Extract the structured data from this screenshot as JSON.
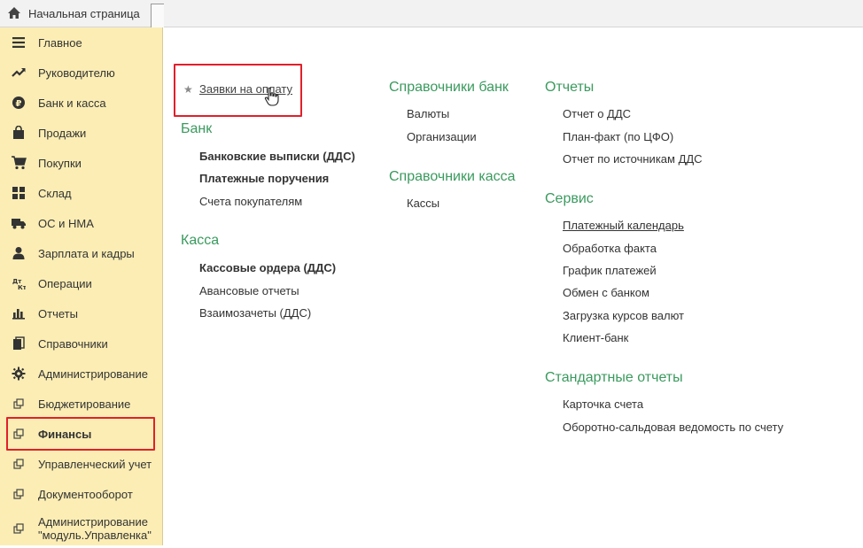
{
  "topbar": {
    "home_label": "Начальная страница",
    "home_icon": "home-icon"
  },
  "sidebar": {
    "items": [
      {
        "label": "Главное",
        "icon": "menu-lines-icon"
      },
      {
        "label": "Руководителю",
        "icon": "trend-icon"
      },
      {
        "label": "Банк и касса",
        "icon": "ruble-coin-icon"
      },
      {
        "label": "Продажи",
        "icon": "shopping-bag-icon"
      },
      {
        "label": "Покупки",
        "icon": "cart-icon"
      },
      {
        "label": "Склад",
        "icon": "grid-icon"
      },
      {
        "label": "ОС и НМА",
        "icon": "truck-icon"
      },
      {
        "label": "Зарплата и кадры",
        "icon": "person-icon"
      },
      {
        "label": "Операции",
        "icon": "dt-kt-icon"
      },
      {
        "label": "Отчеты",
        "icon": "bar-chart-icon"
      },
      {
        "label": "Справочники",
        "icon": "books-icon"
      },
      {
        "label": "Администрирование",
        "icon": "gear-icon"
      },
      {
        "label": "Бюджетирование",
        "icon": "external-link-icon"
      },
      {
        "label": "Финансы",
        "icon": "external-link-icon"
      },
      {
        "label": "Управленческий учет",
        "icon": "external-link-icon"
      },
      {
        "label": "Документооборот",
        "icon": "external-link-icon"
      },
      {
        "label": "Администрирование \"модуль.Управленка\"",
        "icon": "external-link-icon"
      }
    ],
    "active_label": "Финансы"
  },
  "main": {
    "favorite": {
      "label": "Заявки на оплату"
    },
    "bank": {
      "title": "Банк",
      "links": [
        "Банковские выписки (ДДС)",
        "Платежные поручения",
        "Счета покупателям"
      ]
    },
    "kassa": {
      "title": "Касса",
      "links": [
        "Кассовые ордера (ДДС)",
        "Авансовые отчеты",
        "Взаимозачеты (ДДС)"
      ]
    },
    "ref_bank": {
      "title": "Справочники банк",
      "links": [
        "Валюты",
        "Организации"
      ]
    },
    "ref_kassa": {
      "title": "Справочники касса",
      "links": [
        "Кассы"
      ]
    },
    "reports": {
      "title": "Отчеты",
      "links": [
        "Отчет о ДДС",
        "План-факт (по ЦФО)",
        "Отчет по источникам ДДС"
      ]
    },
    "service": {
      "title": "Сервис",
      "links": [
        "Платежный календарь",
        "Обработка факта",
        "График платежей",
        "Обмен с банком",
        "Загрузка курсов валют",
        "Клиент-банк"
      ]
    },
    "std_reports": {
      "title": "Стандартные отчеты",
      "links": [
        "Карточка счета",
        "Оборотно-сальдовая ведомость по счету"
      ]
    }
  },
  "colors": {
    "sidebar_bg": "#fbedb4",
    "section_title": "#3a9a5e",
    "highlight": "#e0202a"
  }
}
